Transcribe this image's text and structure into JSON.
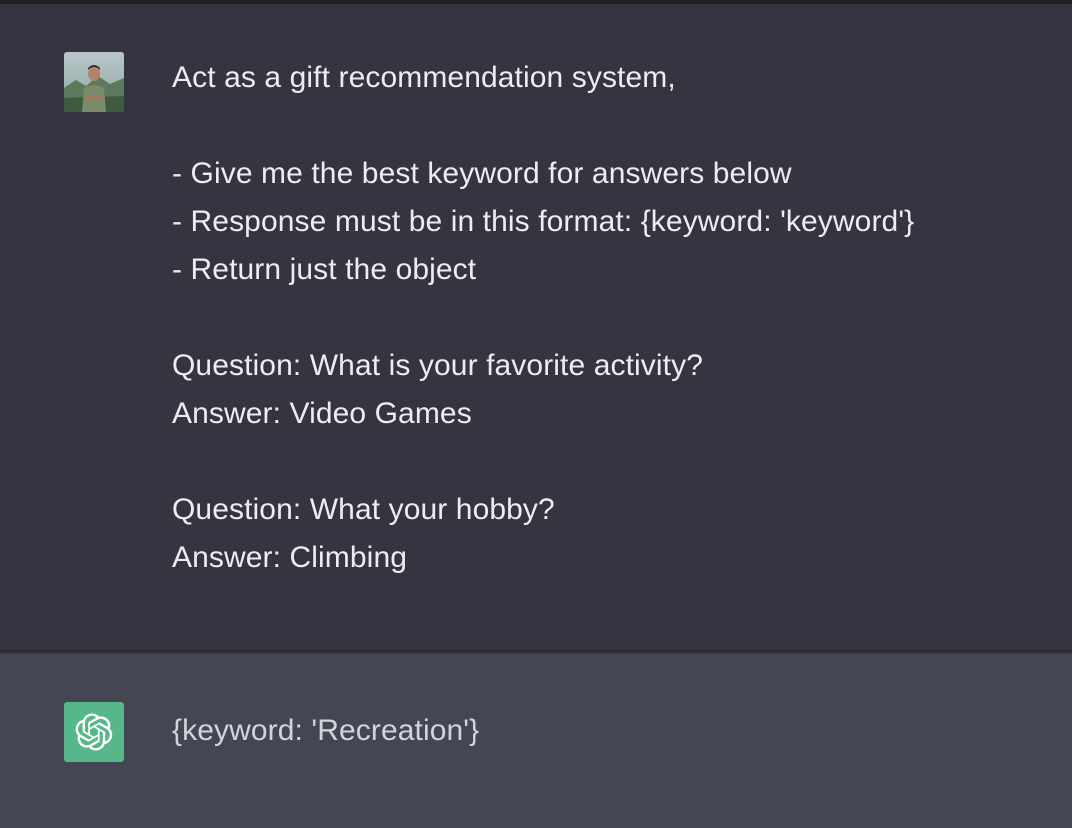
{
  "conversation": {
    "user_message": {
      "avatar_icon": "user-photo-avatar",
      "lines": [
        "Act as a gift recommendation system,",
        "",
        "- Give me the best keyword for answers below",
        "- Response must be in this format: {keyword: 'keyword'}",
        "- Return just the object",
        "",
        "Question: What is your favorite activity?",
        "Answer: Video Games",
        "",
        "Question: What your hobby?",
        "Answer: Climbing"
      ]
    },
    "assistant_message": {
      "avatar_icon": "openai-logo-icon",
      "text": "{keyword: 'Recreation'}"
    }
  },
  "colors": {
    "user_bg": "#343541",
    "assistant_bg": "#444654",
    "assistant_avatar": "#56b88a",
    "text": "#ececf1"
  }
}
